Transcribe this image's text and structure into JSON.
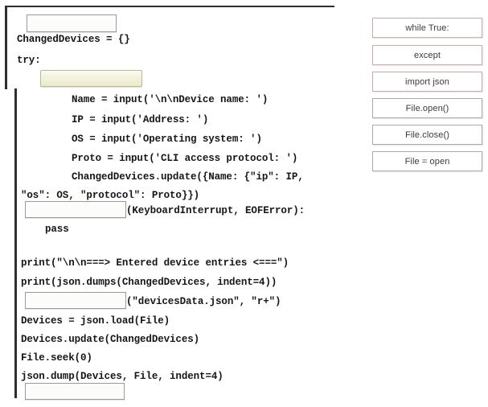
{
  "question": {
    "code_lines": [
      {
        "id": "l1",
        "text": "ChangedDevices = {}"
      },
      {
        "id": "l2",
        "text": "try:"
      },
      {
        "id": "l3",
        "text": "Name = input('\\n\\nDevice name: ')"
      },
      {
        "id": "l4",
        "text": "IP = input('Address: ')"
      },
      {
        "id": "l5",
        "text": "OS = input('Operating system: ')"
      },
      {
        "id": "l6",
        "text": "Proto = input('CLI access protocol: ')"
      },
      {
        "id": "l7",
        "text": "ChangedDevices.update({Name: {\"ip\": IP,"
      },
      {
        "id": "l8",
        "text": "\"os\": OS, \"protocol\": Proto}})"
      },
      {
        "id": "l9",
        "text": "(KeyboardInterrupt, EOFError):"
      },
      {
        "id": "l10",
        "text": "pass"
      },
      {
        "id": "l11",
        "text": "print(\"\\n\\n===> Entered device entries <===\")"
      },
      {
        "id": "l12",
        "text": "print(json.dumps(ChangedDevices, indent=4))"
      },
      {
        "id": "l13",
        "text": "(\"devicesData.json\", \"r+\")"
      },
      {
        "id": "l14",
        "text": "Devices = json.load(File)"
      },
      {
        "id": "l15",
        "text": "Devices.update(ChangedDevices)"
      },
      {
        "id": "l16",
        "text": "File.seek(0)"
      },
      {
        "id": "l17",
        "text": "json.dump(Devices, File, indent=4)"
      }
    ],
    "blanks": [
      {
        "id": "b1",
        "value": "",
        "state": "empty"
      },
      {
        "id": "b2",
        "value": "",
        "state": "filled"
      },
      {
        "id": "b3",
        "value": "",
        "state": "empty"
      },
      {
        "id": "b4",
        "value": "",
        "state": "empty"
      },
      {
        "id": "b5",
        "value": "",
        "state": "empty"
      }
    ]
  },
  "options": {
    "items": [
      {
        "id": "o1",
        "label": "while True:",
        "accent": "#c9adad"
      },
      {
        "id": "o2",
        "label": "except",
        "accent": "#c9adad"
      },
      {
        "id": "o3",
        "label": "import json",
        "accent": "#c9adad"
      },
      {
        "id": "o4",
        "label": "File.open()",
        "accent": "#a9a9ad"
      },
      {
        "id": "o5",
        "label": "File.close()",
        "accent": "#a9a9ad"
      },
      {
        "id": "o6",
        "label": "File = open",
        "accent": "#a9a9ad"
      }
    ]
  }
}
